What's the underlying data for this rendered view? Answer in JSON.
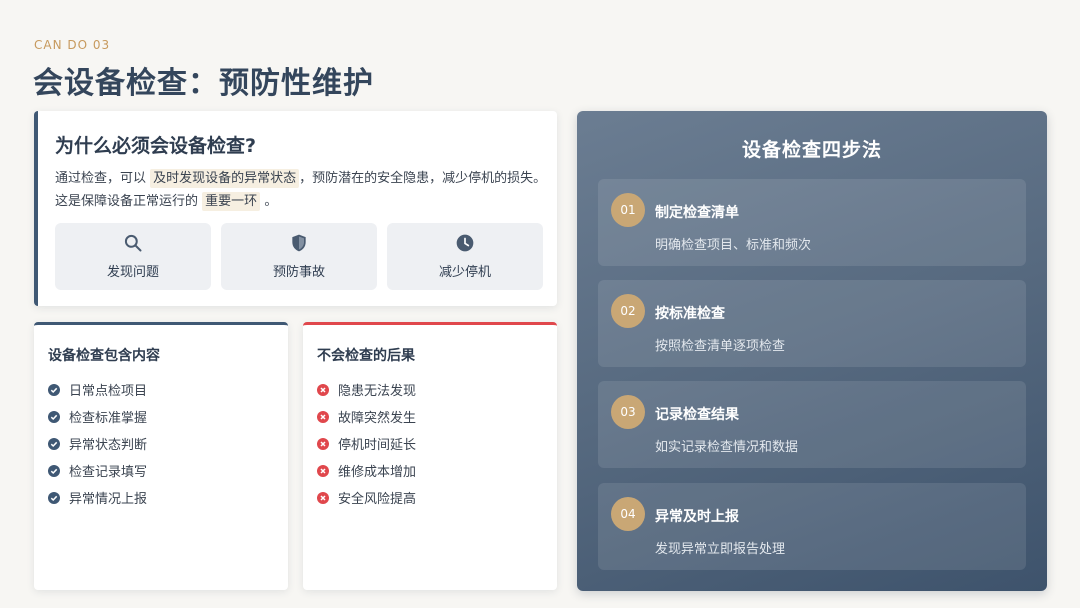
{
  "eyebrow": "CAN DO 03",
  "title": "会设备检查：预防性维护",
  "why": {
    "title": "为什么必须会设备检查?",
    "body_1": "通过检查，可以",
    "highlight_1": "及时发现设备的异常状态",
    "body_2": "，预防潜在的安全隐患，减少停机的损失。这是保障设备正常运行的",
    "highlight_2": "重要一环",
    "body_3": "。",
    "tiles": [
      {
        "icon": "search-icon",
        "label": "发现问题"
      },
      {
        "icon": "shield-icon",
        "label": "预防事故"
      },
      {
        "icon": "clock-icon",
        "label": "减少停机"
      }
    ]
  },
  "contents": {
    "title": "设备检查包含内容",
    "items": [
      "日常点检项目",
      "检查标准掌握",
      "异常状态判断",
      "检查记录填写",
      "异常情况上报"
    ]
  },
  "consequences": {
    "title": "不会检查的后果",
    "items": [
      "隐患无法发现",
      "故障突然发生",
      "停机时间延长",
      "维修成本增加",
      "安全风险提高"
    ]
  },
  "steps": {
    "title": "设备检查四步法",
    "items": [
      {
        "num": "01",
        "title": "制定检查清单",
        "desc": "明确检查项目、标准和频次"
      },
      {
        "num": "02",
        "title": "按标准检查",
        "desc": "按照检查清单逐项检查"
      },
      {
        "num": "03",
        "title": "记录检查结果",
        "desc": "如实记录检查情况和数据"
      },
      {
        "num": "04",
        "title": "异常及时上报",
        "desc": "发现异常立即报告处理"
      }
    ]
  },
  "colors": {
    "accent_navy": "#3f5874",
    "accent_red": "#e0474c",
    "accent_gold": "#c9a775"
  }
}
